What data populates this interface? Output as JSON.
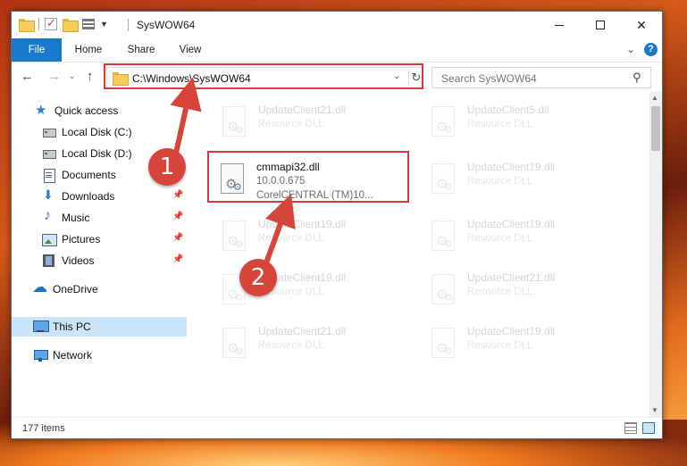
{
  "window": {
    "title": "SysWOW64",
    "minimize_icon": "minimize-icon",
    "maximize_icon": "maximize-icon",
    "close_icon": "close-icon"
  },
  "ribbon": {
    "tabs": [
      {
        "label": "File"
      },
      {
        "label": "Home"
      },
      {
        "label": "Share"
      },
      {
        "label": "View"
      }
    ],
    "file_tab_color": "#1979ca"
  },
  "navigation": {
    "address": "C:\\Windows\\SysWOW64",
    "search_placeholder": "Search SysWOW64"
  },
  "sidebar": {
    "items": [
      {
        "label": "Quick access",
        "icon": "star-icon"
      },
      {
        "label": "Local Disk (C:)",
        "icon": "disk-icon"
      },
      {
        "label": "Local Disk (D:)",
        "icon": "disk-icon"
      },
      {
        "label": "Documents",
        "icon": "documents-icon"
      },
      {
        "label": "Downloads",
        "icon": "download-icon",
        "pinned": true
      },
      {
        "label": "Music",
        "icon": "music-icon",
        "pinned": true
      },
      {
        "label": "Pictures",
        "icon": "pictures-icon",
        "pinned": true
      },
      {
        "label": "Videos",
        "icon": "videos-icon",
        "pinned": true
      },
      {
        "label": "OneDrive",
        "icon": "cloud-icon"
      },
      {
        "label": "This PC",
        "icon": "computer-icon",
        "selected": true
      },
      {
        "label": "Network",
        "icon": "network-icon"
      }
    ]
  },
  "files": [
    {
      "name": "UpdateClient21.dll",
      "type": "Resource DLL",
      "faded": true
    },
    {
      "name": "UpdateClient5.dll",
      "type": "Resource DLL",
      "faded": true
    },
    {
      "name": "cmmapi32.dll",
      "version": "10.0.0.675",
      "company": "CorelCENTRAL (TM)10...",
      "faded": false,
      "highlighted": true
    },
    {
      "name": "UpdateClient19.dll",
      "type": "Resource DLL",
      "faded": true
    },
    {
      "name": "UpdateClient19.dll",
      "type": "Resource DLL",
      "faded": true
    },
    {
      "name": "UpdateClient19.dll",
      "type": "Resource DLL",
      "faded": true
    },
    {
      "name": "UpdateClient19.dll",
      "type": "Resource DLL",
      "faded": true
    },
    {
      "name": "UpdateClient21.dll",
      "type": "Resource DLL",
      "faded": true
    },
    {
      "name": "UpdateClient21.dll",
      "type": "Resource DLL",
      "faded": true
    },
    {
      "name": "UpdateClient19.dll",
      "type": "Resource DLL",
      "faded": true
    }
  ],
  "status": {
    "item_count": "177 items"
  },
  "annotations": {
    "step1": "1",
    "step2": "2",
    "color": "#d7453a"
  }
}
